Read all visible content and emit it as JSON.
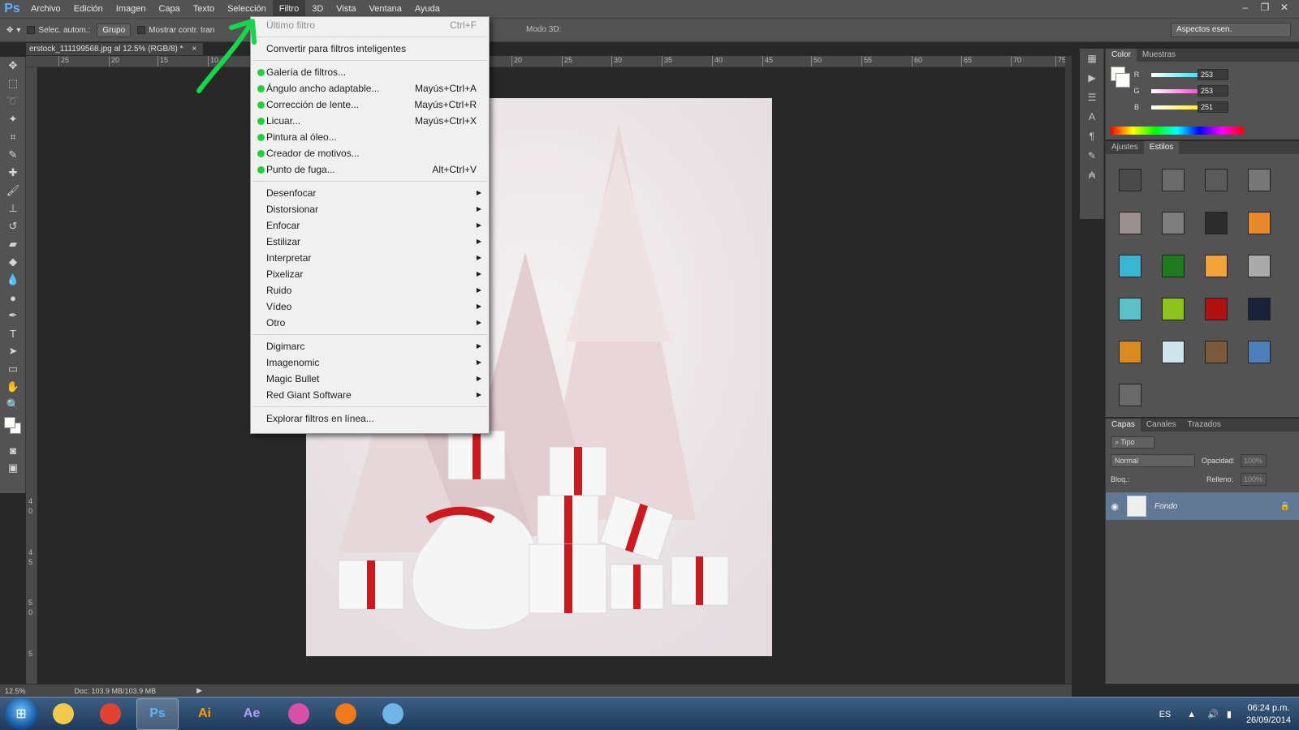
{
  "menubar": {
    "logo": "Ps",
    "items": [
      "Archivo",
      "Edición",
      "Imagen",
      "Capa",
      "Texto",
      "Selección",
      "Filtro",
      "3D",
      "Vista",
      "Ventana",
      "Ayuda"
    ]
  },
  "optionsbar": {
    "auto_select_label": "Selec. autom.:",
    "group_value": "Grupo",
    "show_transform_label": "Mostrar contr. tran",
    "mode3d_label": "Modo 3D:",
    "workspace": "Aspectos esen."
  },
  "document": {
    "tab_title": "erstock_111199568.jpg al 12.5% (RGB/8) *",
    "tab_close": "×",
    "ruler_ticks": [
      "25",
      "20",
      "15",
      "10",
      "20",
      "25",
      "30",
      "35",
      "40",
      "45",
      "50",
      "55",
      "60",
      "65",
      "70",
      "75"
    ],
    "left_ruler_ticks": [
      "4",
      "0",
      "4",
      "5",
      "5",
      "0",
      "5"
    ]
  },
  "statusbar": {
    "zoom": "12.5%",
    "doc_info": "Doc: 103.9 MB/103.9 MB"
  },
  "filter_menu": {
    "last_filter": {
      "label": "Último filtro",
      "shortcut": "Ctrl+F"
    },
    "convert_smart": "Convertir para filtros inteligentes",
    "group1": [
      {
        "label": "Galería de filtros...",
        "shortcut": ""
      },
      {
        "label": "Ángulo ancho adaptable...",
        "shortcut": "Mayús+Ctrl+A"
      },
      {
        "label": "Corrección de lente...",
        "shortcut": "Mayús+Ctrl+R"
      },
      {
        "label": "Licuar...",
        "shortcut": "Mayús+Ctrl+X"
      },
      {
        "label": "Pintura al óleo...",
        "shortcut": ""
      },
      {
        "label": "Creador de motivos...",
        "shortcut": ""
      },
      {
        "label": "Punto de fuga...",
        "shortcut": "Alt+Ctrl+V"
      }
    ],
    "submenus": [
      "Desenfocar",
      "Distorsionar",
      "Enfocar",
      "Estilizar",
      "Interpretar",
      "Pixelizar",
      "Ruido",
      "Vídeo",
      "Otro"
    ],
    "plugins": [
      "Digimarc",
      "Imagenomic",
      "Magic Bullet",
      "Red Giant Software"
    ],
    "browse": "Explorar filtros en línea..."
  },
  "color_panel": {
    "tabs": [
      "Color",
      "Muestras"
    ],
    "channels": [
      {
        "label": "R",
        "value": "253",
        "gradient_color": "#00e5ff"
      },
      {
        "label": "G",
        "value": "253",
        "gradient_color": "#ff2bd8"
      },
      {
        "label": "B",
        "value": "251",
        "gradient_color": "#ffea00"
      }
    ]
  },
  "styles_panel": {
    "tabs": [
      "Ajustes",
      "Estilos"
    ],
    "swatches": [
      "#4a4a4a",
      "#6b6b6b",
      "#5a5a5a",
      "#777777",
      "#9a8f8f",
      "#7e7e7e",
      "#2c2c2c",
      "#e88a2b",
      "#38b6d4",
      "#1e7a1e",
      "#f2a33a",
      "#aaaaaa",
      "#58c2c8",
      "#8bc21c",
      "#b11111",
      "#182238",
      "#d98b1f",
      "#cfe4ea",
      "#7a5a3a",
      "#4f7fb8",
      "#6a6a6a"
    ]
  },
  "layers_panel": {
    "tabs": [
      "Capas",
      "Canales",
      "Trazados"
    ],
    "kind_filter": "Tipo",
    "blend_mode": "Normal",
    "opacity_label": "Opacidad:",
    "opacity_value": "100%",
    "lock_label": "Bloq.:",
    "fill_label": "Relleno:",
    "fill_value": "100%",
    "layer_name": "Fondo"
  },
  "taskbar": {
    "apps": [
      {
        "name": "explorer",
        "label": "",
        "color": "#f2c94c"
      },
      {
        "name": "chrome",
        "label": "",
        "color": "#e34133"
      },
      {
        "name": "photoshop",
        "label": "Ps",
        "color": "#5fb0ff"
      },
      {
        "name": "illustrator",
        "label": "Ai",
        "color": "#ff9a00"
      },
      {
        "name": "after-effects",
        "label": "Ae",
        "color": "#b49bff"
      },
      {
        "name": "app5",
        "label": "",
        "color": "#d84fa8"
      },
      {
        "name": "firefox",
        "label": "",
        "color": "#f07a1a"
      },
      {
        "name": "photo-viewer",
        "label": "",
        "color": "#6fb4e6"
      }
    ],
    "language": "ES",
    "time": "06:24 p.m.",
    "date": "26/09/2014"
  }
}
